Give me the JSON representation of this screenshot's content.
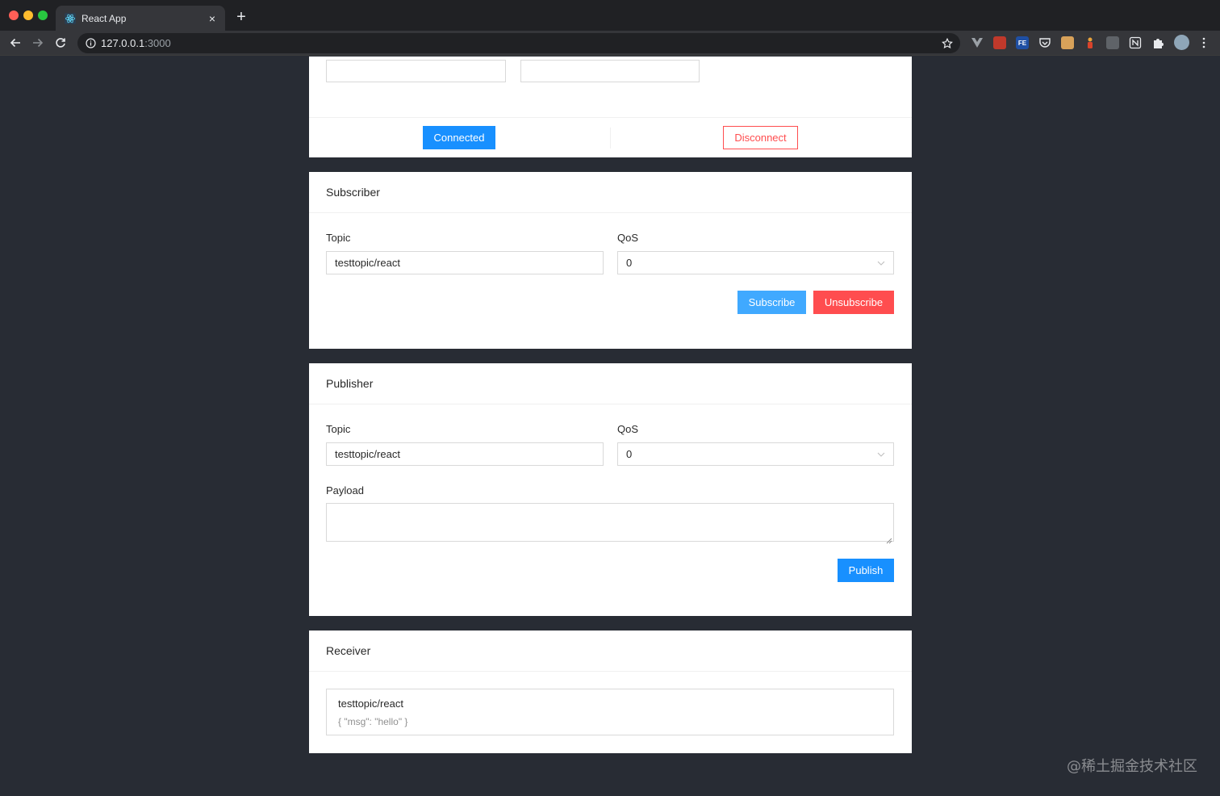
{
  "browser": {
    "tab_title": "React App",
    "tab_close": "×",
    "new_tab": "+",
    "url_host": "127.0.0.1",
    "url_port": ":3000"
  },
  "connection": {
    "connect_button": "Connected",
    "disconnect_button": "Disconnect"
  },
  "subscriber": {
    "title": "Subscriber",
    "topic_label": "Topic",
    "topic_value": "testtopic/react",
    "qos_label": "QoS",
    "qos_value": "0",
    "subscribe_button": "Subscribe",
    "unsubscribe_button": "Unsubscribe"
  },
  "publisher": {
    "title": "Publisher",
    "topic_label": "Topic",
    "topic_value": "testtopic/react",
    "qos_label": "QoS",
    "qos_value": "0",
    "payload_label": "Payload",
    "payload_value": "",
    "publish_button": "Publish"
  },
  "receiver": {
    "title": "Receiver",
    "messages": [
      {
        "topic": "testtopic/react",
        "payload": "{ \"msg\": \"hello\" }"
      }
    ]
  },
  "watermark": "@稀土掘金技术社区",
  "colors": {
    "page_bg": "#282c34",
    "primary": "#1890ff",
    "danger": "#ff4d4f"
  }
}
